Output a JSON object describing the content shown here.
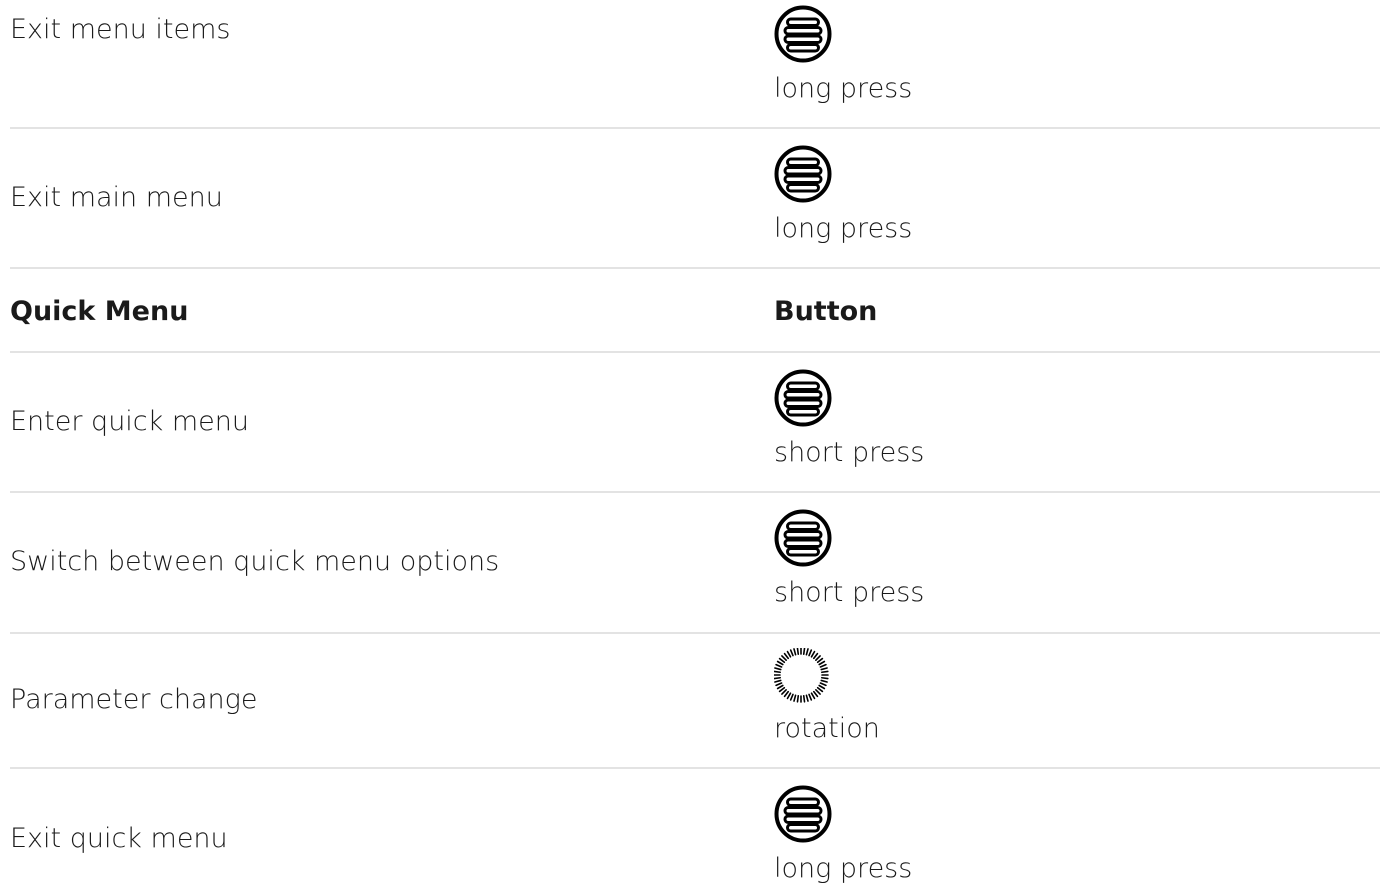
{
  "rows": [
    {
      "type": "action",
      "description": "Exit menu items",
      "icon": "menu-button-icon",
      "action": "long press"
    },
    {
      "type": "action",
      "description": "Exit main menu",
      "icon": "menu-button-icon",
      "action": "long press"
    },
    {
      "type": "header",
      "description": "Quick Menu",
      "button_header": "Button"
    },
    {
      "type": "action",
      "description": "Enter quick menu",
      "icon": "menu-button-icon",
      "action": "short press"
    },
    {
      "type": "action",
      "description": "Switch between quick menu options",
      "icon": "menu-button-icon",
      "action": "short press"
    },
    {
      "type": "action",
      "description": "Parameter change",
      "icon": "rotation-dial-icon",
      "action": "rotation"
    },
    {
      "type": "action",
      "description": "Exit quick menu",
      "icon": "menu-button-icon",
      "action": "long press"
    }
  ]
}
